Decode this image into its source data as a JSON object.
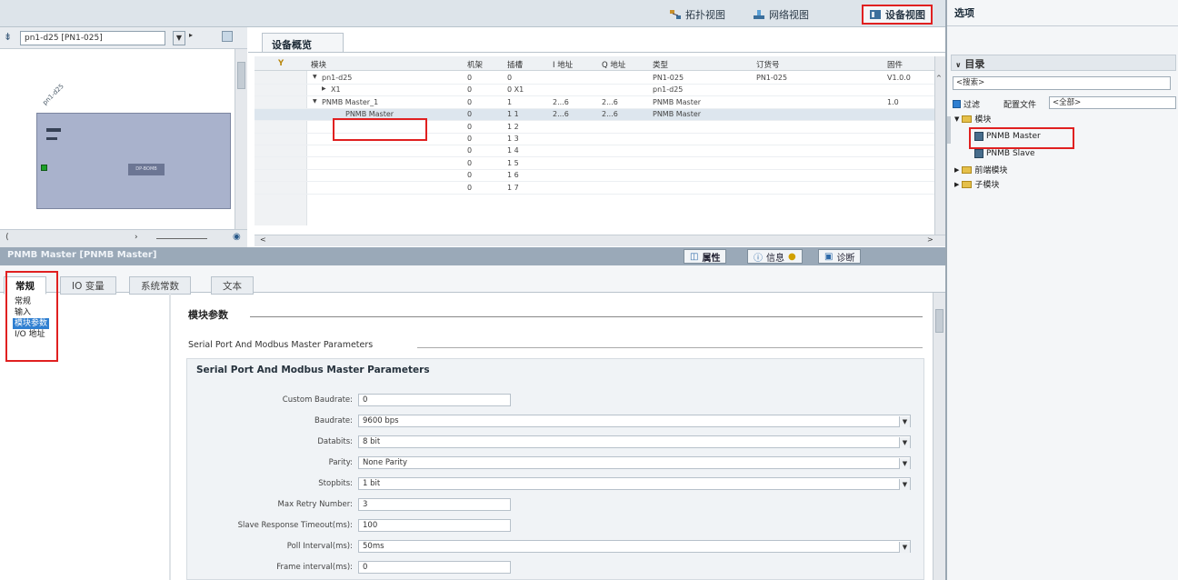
{
  "view_buttons": {
    "topology": "拓扑视图",
    "network": "网络视图",
    "device": "设备视图"
  },
  "graphic_panel": {
    "device_select": "pn1-d25 [PN1-025]",
    "device_rotated_label": "pn1-d25",
    "device_tag": "DP-BOMB"
  },
  "overview": {
    "tab": "设备概览",
    "columns": {
      "module": "模块",
      "rack": "机架",
      "slot": "插槽",
      "i_addr": "I 地址",
      "q_addr": "Q 地址",
      "type": "类型",
      "order_no": "订货号",
      "firmware": "固件"
    },
    "rows": [
      {
        "module": "pn1-d25",
        "rack": "0",
        "slot": "0",
        "i": "",
        "q": "",
        "type": "PN1-025",
        "order": "PN1-025",
        "fw": "V1.0.0",
        "caret": "▼"
      },
      {
        "module": "X1",
        "rack": "0",
        "slot": "0 X1",
        "i": "",
        "q": "",
        "type": "pn1-d25",
        "order": "",
        "fw": "",
        "caret": "▶"
      },
      {
        "module": "PNMB Master_1",
        "rack": "0",
        "slot": "1",
        "i": "2...6",
        "q": "2...6",
        "type": "PNMB Master",
        "order": "",
        "fw": "1.0",
        "caret": "▼"
      },
      {
        "module": "PNMB Master",
        "rack": "0",
        "slot": "1 1",
        "i": "2...6",
        "q": "2...6",
        "type": "PNMB Master",
        "order": "",
        "fw": "",
        "caret": ""
      },
      {
        "module": "",
        "rack": "0",
        "slot": "1 2",
        "i": "",
        "q": "",
        "type": "",
        "order": "",
        "fw": "",
        "caret": ""
      },
      {
        "module": "",
        "rack": "0",
        "slot": "1 3",
        "i": "",
        "q": "",
        "type": "",
        "order": "",
        "fw": "",
        "caret": ""
      },
      {
        "module": "",
        "rack": "0",
        "slot": "1 4",
        "i": "",
        "q": "",
        "type": "",
        "order": "",
        "fw": "",
        "caret": ""
      },
      {
        "module": "",
        "rack": "0",
        "slot": "1 5",
        "i": "",
        "q": "",
        "type": "",
        "order": "",
        "fw": "",
        "caret": ""
      },
      {
        "module": "",
        "rack": "0",
        "slot": "1 6",
        "i": "",
        "q": "",
        "type": "",
        "order": "",
        "fw": "",
        "caret": ""
      },
      {
        "module": "",
        "rack": "0",
        "slot": "1 7",
        "i": "",
        "q": "",
        "type": "",
        "order": "",
        "fw": "",
        "caret": ""
      }
    ]
  },
  "inspector": {
    "title": "PNMB Master [PNMB Master]",
    "tab_properties": "属性",
    "tab_info": "信息",
    "tab_diag": "诊断",
    "tabs": [
      "常规",
      "IO 变量",
      "系统常数",
      "文本"
    ],
    "nav": [
      "常规",
      "输入",
      "模块参数",
      "I/O 地址"
    ]
  },
  "params": {
    "section_title": "模块参数",
    "subsection": "Serial Port And Modbus Master Parameters",
    "group_title": "Serial Port And Modbus Master Parameters",
    "fields": [
      {
        "label": "Custom Baudrate:",
        "value": "0"
      },
      {
        "label": "Baudrate:",
        "value": "9600 bps"
      },
      {
        "label": "Databits:",
        "value": "8 bit"
      },
      {
        "label": "Parity:",
        "value": "None Parity"
      },
      {
        "label": "Stopbits:",
        "value": "1 bit"
      },
      {
        "label": "Max Retry Number:",
        "value": "3"
      },
      {
        "label": "Slave Response Timeout(ms):",
        "value": "100"
      },
      {
        "label": "Poll Interval(ms):",
        "value": "50ms"
      },
      {
        "label": "Frame interval(ms):",
        "value": "0"
      }
    ]
  },
  "catalog": {
    "title": "选项",
    "section": "目录",
    "search_value": "<搜索>",
    "filter_label": "过滤",
    "profile_label": "配置文件",
    "profile_value": "<全部>",
    "tree": {
      "modules": "模块",
      "master": "PNMB Master",
      "slave": "PNMB Slave",
      "front_modules": "前端模块",
      "sub_modules": "子模块"
    }
  },
  "colors": {
    "highlight_red": "#e02020",
    "selection_blue": "#2f7fd1",
    "inspector_header": "#9aa9b8"
  }
}
